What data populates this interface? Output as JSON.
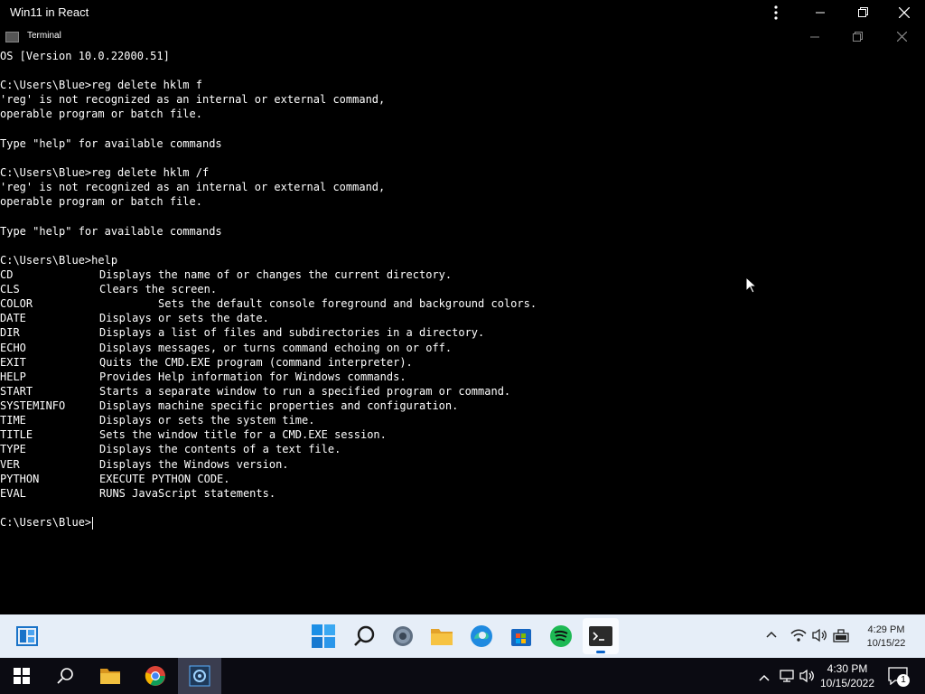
{
  "app": {
    "title": "Win11 in React"
  },
  "window": {
    "title": "Terminal"
  },
  "terminal": {
    "lines": [
      "OS [Version 10.0.22000.51]",
      "",
      "C:\\Users\\Blue>reg delete hklm f",
      "'reg' is not recognized as an internal or external command,",
      "operable program or batch file.",
      "",
      "Type \"help\" for available commands",
      "",
      "C:\\Users\\Blue>reg delete hklm /f",
      "'reg' is not recognized as an internal or external command,",
      "operable program or batch file.",
      "",
      "Type \"help\" for available commands",
      "",
      "C:\\Users\\Blue>help"
    ],
    "help": [
      {
        "cmd": "CD",
        "desc": "Displays the name of or changes the current directory."
      },
      {
        "cmd": "CLS",
        "desc": "Clears the screen."
      },
      {
        "cmd": "COLOR",
        "desc": "         Sets the default console foreground and background colors."
      },
      {
        "cmd": "DATE",
        "desc": "Displays or sets the date."
      },
      {
        "cmd": "DIR",
        "desc": "Displays a list of files and subdirectories in a directory."
      },
      {
        "cmd": "ECHO",
        "desc": "Displays messages, or turns command echoing on or off."
      },
      {
        "cmd": "EXIT",
        "desc": "Quits the CMD.EXE program (command interpreter)."
      },
      {
        "cmd": "HELP",
        "desc": "Provides Help information for Windows commands."
      },
      {
        "cmd": "START",
        "desc": "Starts a separate window to run a specified program or command."
      },
      {
        "cmd": "SYSTEMINFO",
        "desc": "Displays machine specific properties and configuration."
      },
      {
        "cmd": "TIME",
        "desc": "Displays or sets the system time."
      },
      {
        "cmd": "TITLE",
        "desc": "Sets the window title for a CMD.EXE session."
      },
      {
        "cmd": "TYPE",
        "desc": "Displays the contents of a text file."
      },
      {
        "cmd": "VER",
        "desc": "Displays the Windows version."
      },
      {
        "cmd": "PYTHON",
        "desc": "EXECUTE PYTHON CODE."
      },
      {
        "cmd": "EVAL",
        "desc": "RUNS JavaScript statements."
      }
    ],
    "prompt": "C:\\Users\\Blue>"
  },
  "win11_taskbar": {
    "time": "4:29 PM",
    "date": "10/15/22",
    "icons": [
      "widgets-icon",
      "start-icon",
      "search-icon",
      "settings-icon",
      "file-explorer-icon",
      "edge-icon",
      "store-icon",
      "spotify-icon",
      "terminal-icon"
    ],
    "tray_icons": [
      "chevron-up-icon",
      "wifi-icon",
      "volume-icon",
      "battery-icon"
    ]
  },
  "host_taskbar": {
    "time": "4:30 PM",
    "date": "10/15/2022",
    "notification_count": "1",
    "icons": [
      "windows-start-icon",
      "search-icon",
      "file-explorer-icon",
      "chrome-icon",
      "app-icon"
    ],
    "tray_icons": [
      "chevron-up-icon",
      "network-icon",
      "volume-icon",
      "notification-icon"
    ]
  },
  "colors": {
    "terminal_bg": "#000000",
    "terminal_text": "#ffffff",
    "win11_taskbar_bg": "#e6eef8",
    "host_taskbar_bg": "#0b0b12",
    "accent": "#0a63c9"
  }
}
